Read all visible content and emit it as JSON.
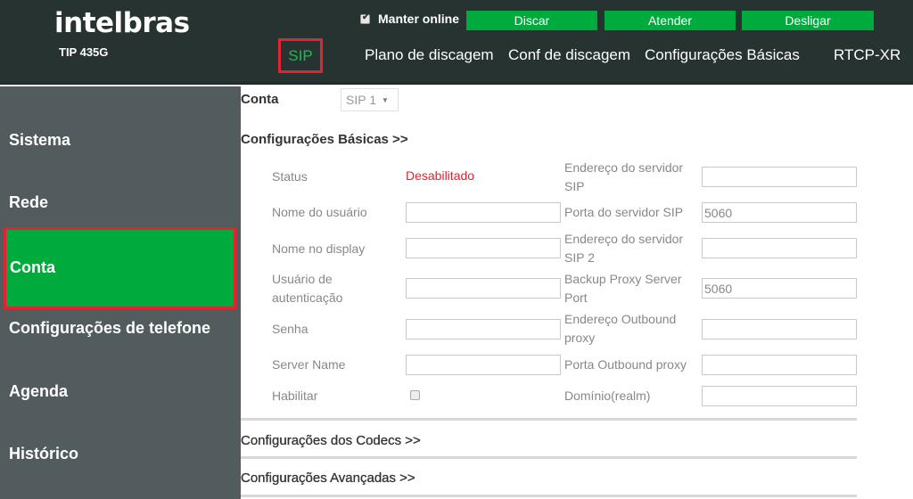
{
  "header": {
    "logo": "intelbras",
    "model": "TIP 435G",
    "keep_online": {
      "label": "Manter online",
      "checked": true
    },
    "buttons": {
      "dial": "Discar",
      "answer": "Atender",
      "hangup": "Desligar"
    },
    "nav": [
      {
        "label": "SIP",
        "active": true
      },
      {
        "label": "Plano de discagem"
      },
      {
        "label": "Conf de discagem"
      },
      {
        "label": "Configurações Básicas"
      },
      {
        "label": "RTCP-XR"
      }
    ]
  },
  "sidebar": {
    "items": [
      {
        "label": "Sistema"
      },
      {
        "label": "Rede"
      },
      {
        "label": "Conta",
        "active": true
      },
      {
        "label": "Configurações de telefone"
      },
      {
        "label": "Agenda"
      },
      {
        "label": "Histórico"
      }
    ]
  },
  "main": {
    "account_label": "Conta",
    "account_select": "SIP 1",
    "basic_section": "Configurações Básicas >>",
    "left_fields": {
      "status": {
        "label": "Status",
        "value": "Desabilitado"
      },
      "username": {
        "label": "Nome do usuário",
        "value": ""
      },
      "display_name": {
        "label": "Nome no display",
        "value": ""
      },
      "auth_user": {
        "label1": "Usuário de",
        "label2": "autenticação",
        "value": ""
      },
      "password": {
        "label": "Senha",
        "value": ""
      },
      "server_name": {
        "label": "Server Name",
        "value": ""
      },
      "enable": {
        "label": "Habilitar",
        "checked": false
      }
    },
    "right_fields": {
      "sip_server": {
        "label1": "Endereço do servidor",
        "label2": "SIP",
        "value": ""
      },
      "sip_port": {
        "label": "Porta do servidor SIP",
        "value": "5060"
      },
      "sip_server2": {
        "label1": "Endereço do servidor",
        "label2": "SIP 2",
        "value": ""
      },
      "backup_port": {
        "label1": "Backup Proxy Server",
        "label2": "Port",
        "value": "5060"
      },
      "outbound_addr": {
        "label1": "Endereço Outbound",
        "label2": "proxy",
        "value": ""
      },
      "outbound_port": {
        "label": "Porta Outbound proxy",
        "value": ""
      },
      "realm": {
        "label": "Domínio(realm)",
        "value": ""
      }
    },
    "codecs_section": "Configurações dos Codecs >>",
    "advanced_section": "Configurações Avançadas >>"
  },
  "colors": {
    "accent_green": "#00ab3e",
    "highlight_red": "#e52231",
    "header_bg": "#273330",
    "sidebar_bg": "#525b5d",
    "status_red": "#e5202e"
  }
}
